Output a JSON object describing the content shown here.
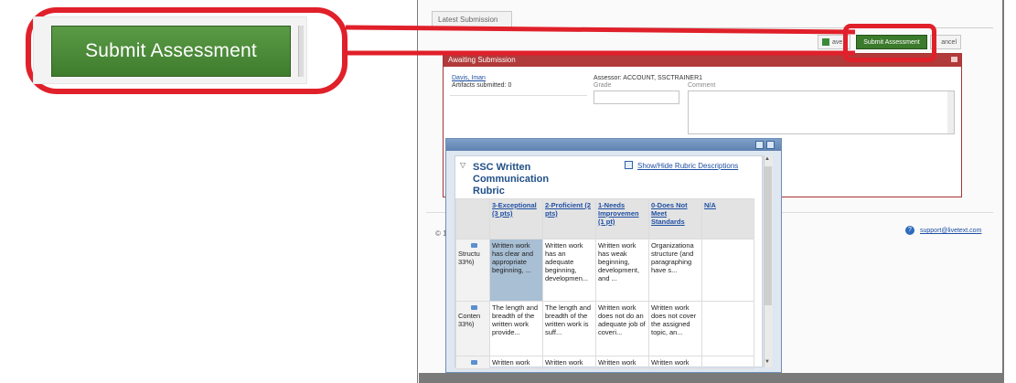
{
  "callout": {
    "button_label": "Submit Assessment"
  },
  "app": {
    "tab_label": "Latest Submission",
    "toolbar": {
      "save_label": "ave",
      "submit_label": "Submit Assessment",
      "cancel_label": "ancel"
    },
    "awaiting": {
      "header": "Awaiting Submission",
      "student_name": "Davis, Iman",
      "artifacts": "Artifacts submitted: 0",
      "assessor": "Assessor: ACCOUNT, SSCTRAINER1",
      "grade_label": "Grade",
      "comment_label": "Comment"
    },
    "footer": {
      "copyright": "© 1",
      "support_email": "support@livetext.com",
      "help_glyph": "?"
    }
  },
  "rubric": {
    "title": "SSC Written Communication Rubric",
    "show_hide": "Show/Hide Rubric Descriptions",
    "levels": [
      "3-Exceptional (3 pts)",
      "2-Proficient (2 pts)",
      "1-Needs Improvemen (1 pt)",
      "0-Does Not Meet Standards",
      "N/A"
    ],
    "rows": [
      {
        "criterion": "Structu 33%)",
        "cells": [
          "Written work has clear and appropriate beginning, ...",
          "Written work has an adequate beginning, developmen...",
          "Written work has weak beginning, development, and ...",
          "Organizationa structure (and paragraphing have s...",
          ""
        ]
      },
      {
        "criterion": "Conten 33%)",
        "cells": [
          "The length and breadth of the written work provide...",
          "The length and breadth of the written work is suff...",
          "Written work does not do an adequate job of coveri...",
          "Written work does not cover the assigned topic, an...",
          ""
        ]
      },
      {
        "criterion": "",
        "cells": [
          "Written work",
          "Written work",
          "Written work",
          "Written work",
          ""
        ]
      }
    ]
  },
  "colors": {
    "accent_red": "#e0202a",
    "submit_green": "#3c7a2c",
    "header_red": "#b13a3a",
    "link_blue": "#1f4fa3"
  }
}
